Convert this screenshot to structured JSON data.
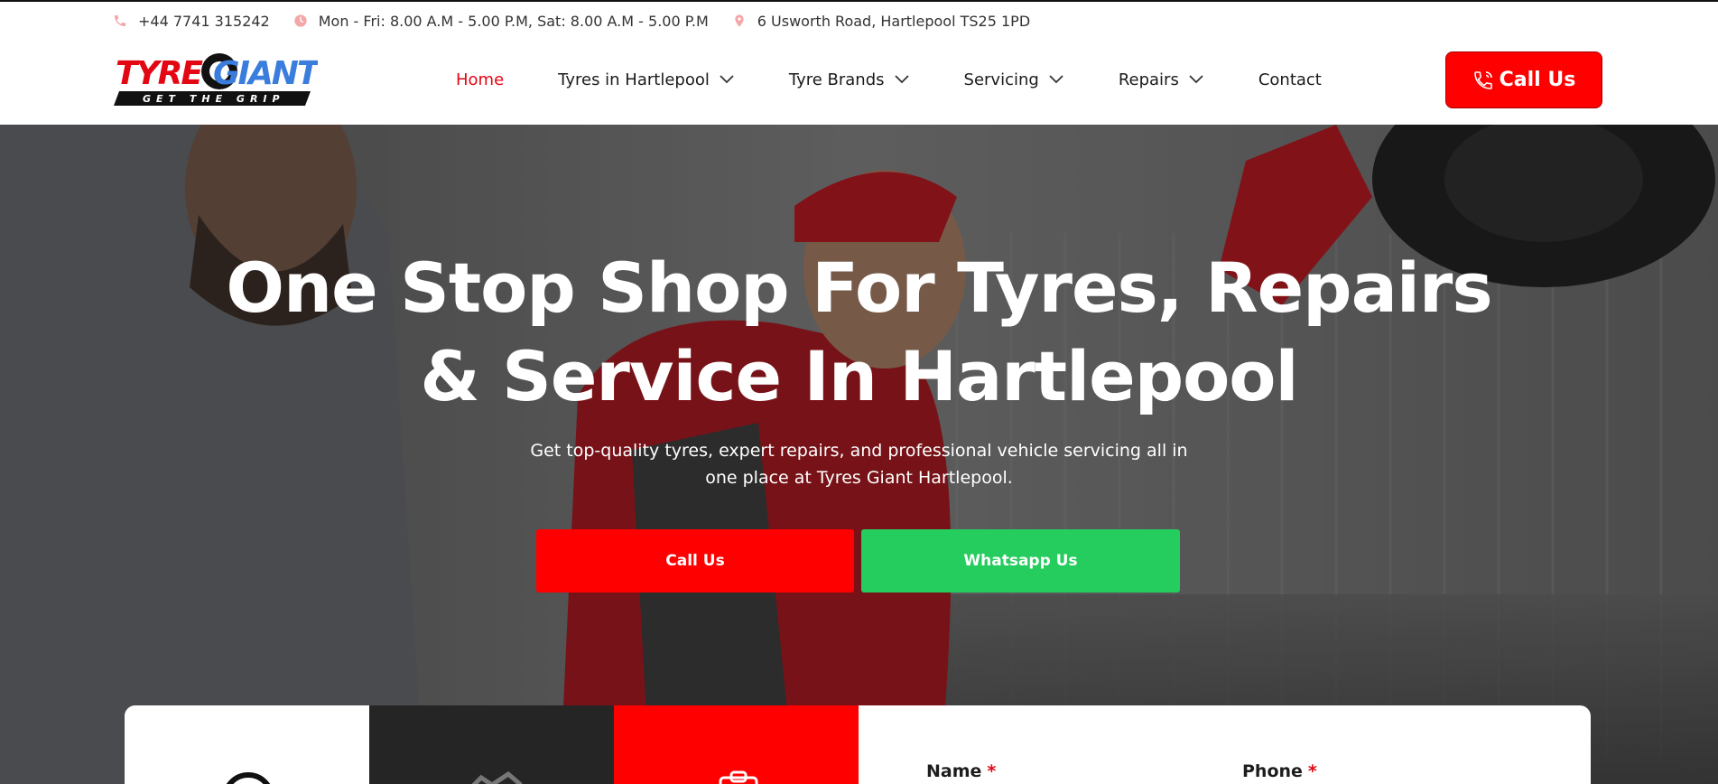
{
  "topbar": {
    "phone": "+44 7741 315242",
    "hours": "Mon - Fri: 8.00 A.M - 5.00 P.M, Sat: 8.00 A.M - 5.00 P.M",
    "address": "6 Usworth Road, Hartlepool TS25 1PD"
  },
  "logo": {
    "text_tyre": "TYRE",
    "text_giant": "GIANT",
    "tagline": "GET THE GRIP"
  },
  "nav": {
    "items": [
      {
        "label": "Home",
        "active": true,
        "dropdown": false
      },
      {
        "label": "Tyres in Hartlepool",
        "active": false,
        "dropdown": true
      },
      {
        "label": "Tyre Brands",
        "active": false,
        "dropdown": true
      },
      {
        "label": "Servicing",
        "active": false,
        "dropdown": true
      },
      {
        "label": "Repairs",
        "active": false,
        "dropdown": true
      },
      {
        "label": "Contact",
        "active": false,
        "dropdown": false
      }
    ],
    "call_label": "Call Us"
  },
  "hero": {
    "title_line1": "One Stop Shop For Tyres, Repairs",
    "title_line2": "& Service In Hartlepool",
    "subtitle_line1": "Get top-quality tyres, expert repairs, and professional vehicle servicing all in",
    "subtitle_line2": "one place at Tyres Giant Hartlepool.",
    "cta_call": "Call Us",
    "cta_whatsapp": "Whatsapp Us"
  },
  "form": {
    "name_label": "Name",
    "phone_label": "Phone",
    "required_mark": "*"
  },
  "colors": {
    "brand_red": "#ff0000",
    "active_nav": "#e30613",
    "whatsapp_green": "#25cc5e",
    "logo_blue": "#3b7ddd",
    "dark_card": "#252525"
  },
  "icons": {
    "phone": "phone-icon",
    "hours": "clock-icon",
    "address": "location-pin-icon",
    "dropdown": "chevron-down-icon",
    "call": "phone-call-icon"
  }
}
